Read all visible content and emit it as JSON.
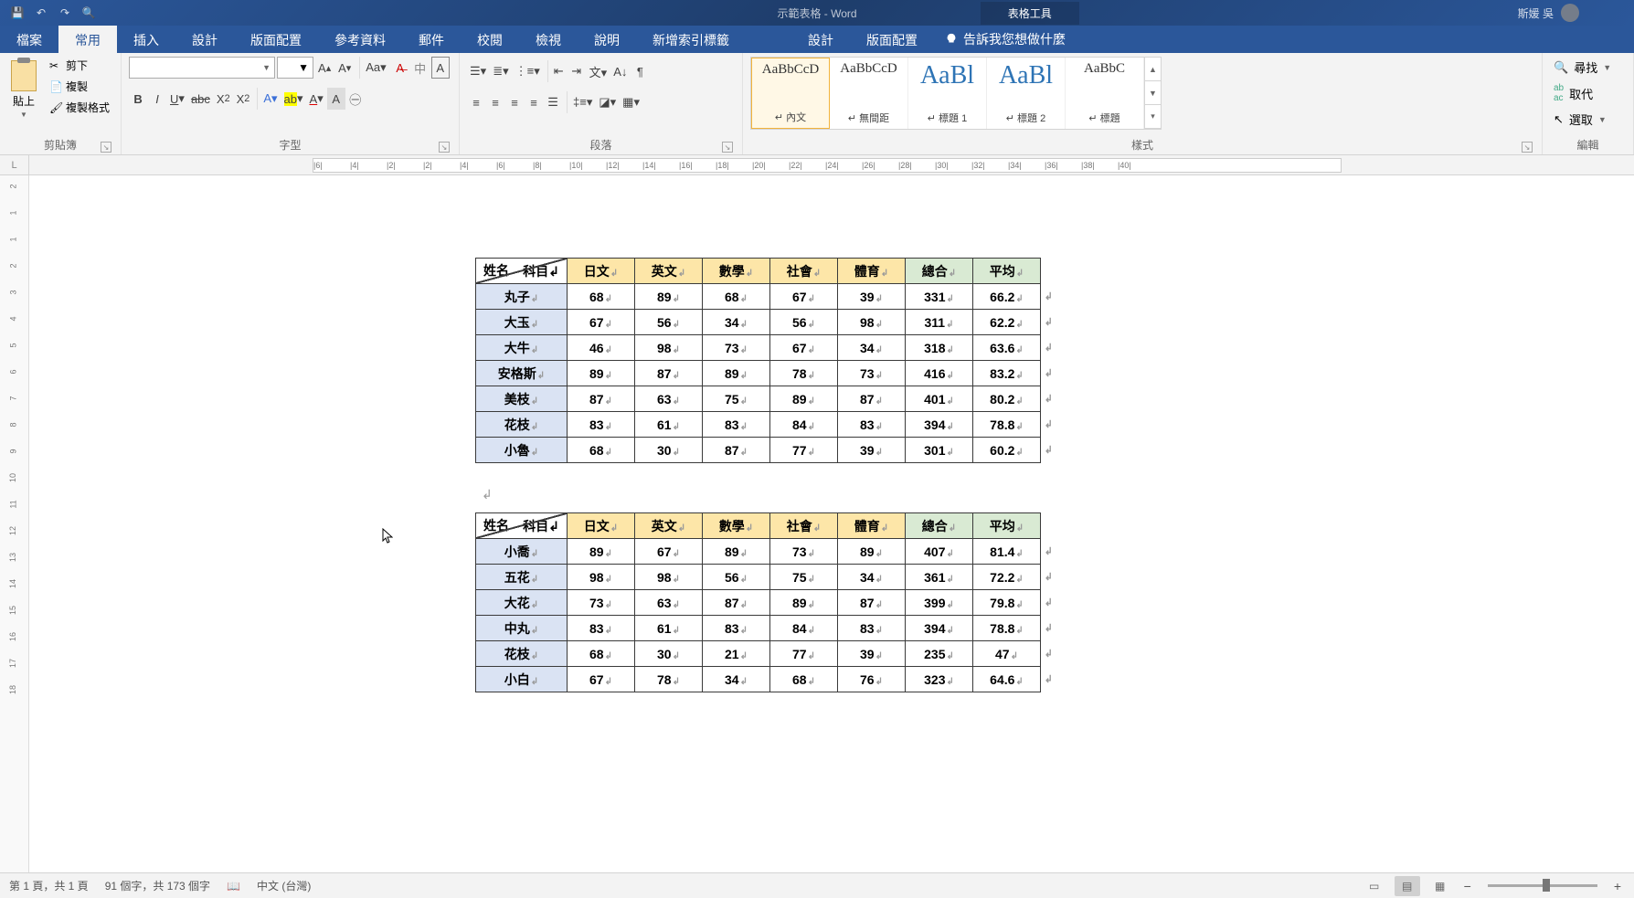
{
  "title": "示範表格 - Word",
  "tabletools": "表格工具",
  "user": "斯媛 吳",
  "menu": [
    "檔案",
    "常用",
    "插入",
    "設計",
    "版面配置",
    "參考資料",
    "郵件",
    "校閱",
    "檢視",
    "說明",
    "新增索引標籤"
  ],
  "menu_ctx": [
    "設計",
    "版面配置"
  ],
  "tell_me": "告訴我您想做什麼",
  "clipboard": {
    "label": "剪貼簿",
    "paste": "貼上",
    "cut": "剪下",
    "copy": "複製",
    "fmt": "複製格式"
  },
  "font": {
    "label": "字型"
  },
  "para": {
    "label": "段落"
  },
  "styles": {
    "label": "樣式",
    "items": [
      {
        "prev": "AaBbCcD",
        "name": "內文",
        "sel": true
      },
      {
        "prev": "AaBbCcD",
        "name": "無間距"
      },
      {
        "prev": "AaBl",
        "name": "標題 1",
        "big": true
      },
      {
        "prev": "AaBl",
        "name": "標題 2",
        "big": true
      },
      {
        "prev": "AaBbC",
        "name": "標題"
      }
    ]
  },
  "editing": {
    "label": "編輯",
    "find": "尋找",
    "replace": "取代",
    "select": "選取"
  },
  "tbl_header": {
    "subj": "科目",
    "name": "姓名",
    "cols": [
      "日文",
      "英文",
      "數學",
      "社會",
      "體育",
      "總合",
      "平均"
    ]
  },
  "table1": [
    {
      "n": "丸子",
      "v": [
        68,
        89,
        68,
        67,
        39,
        331,
        66.2
      ]
    },
    {
      "n": "大玉",
      "v": [
        67,
        56,
        34,
        56,
        98,
        311,
        62.2
      ]
    },
    {
      "n": "大牛",
      "v": [
        46,
        98,
        73,
        67,
        34,
        318,
        63.6
      ]
    },
    {
      "n": "安格斯",
      "v": [
        89,
        87,
        89,
        78,
        73,
        416,
        83.2
      ]
    },
    {
      "n": "美枝",
      "v": [
        87,
        63,
        75,
        89,
        87,
        401,
        80.2
      ]
    },
    {
      "n": "花枝",
      "v": [
        83,
        61,
        83,
        84,
        83,
        394,
        78.8
      ]
    },
    {
      "n": "小魯",
      "v": [
        68,
        30,
        87,
        77,
        39,
        301,
        60.2
      ]
    }
  ],
  "table2": [
    {
      "n": "小喬",
      "v": [
        89,
        67,
        89,
        73,
        89,
        407,
        81.4
      ]
    },
    {
      "n": "五花",
      "v": [
        98,
        98,
        56,
        75,
        34,
        361,
        72.2
      ]
    },
    {
      "n": "大花",
      "v": [
        73,
        63,
        87,
        89,
        87,
        399,
        79.8
      ]
    },
    {
      "n": "中丸",
      "v": [
        83,
        61,
        83,
        84,
        83,
        394,
        78.8
      ]
    },
    {
      "n": "花枝",
      "v": [
        68,
        30,
        21,
        77,
        39,
        235,
        47
      ]
    },
    {
      "n": "小白",
      "v": [
        67,
        78,
        34,
        68,
        76,
        323,
        64.6
      ]
    }
  ],
  "status": {
    "page": "第 1 頁，共 1 頁",
    "words": "91 個字，共 173 個字",
    "lang": "中文 (台灣)"
  },
  "ruler_h": [
    "6",
    "4",
    "2",
    "2",
    "4",
    "6",
    "8",
    "10",
    "12",
    "14",
    "16",
    "18",
    "20",
    "22",
    "24",
    "26",
    "28",
    "30",
    "32",
    "34",
    "36",
    "38",
    "40"
  ],
  "ruler_v": [
    "2",
    "1",
    "1",
    "2",
    "3",
    "4",
    "5",
    "6",
    "7",
    "8",
    "9",
    "10",
    "11",
    "12",
    "13",
    "14",
    "15",
    "16",
    "17",
    "18"
  ]
}
